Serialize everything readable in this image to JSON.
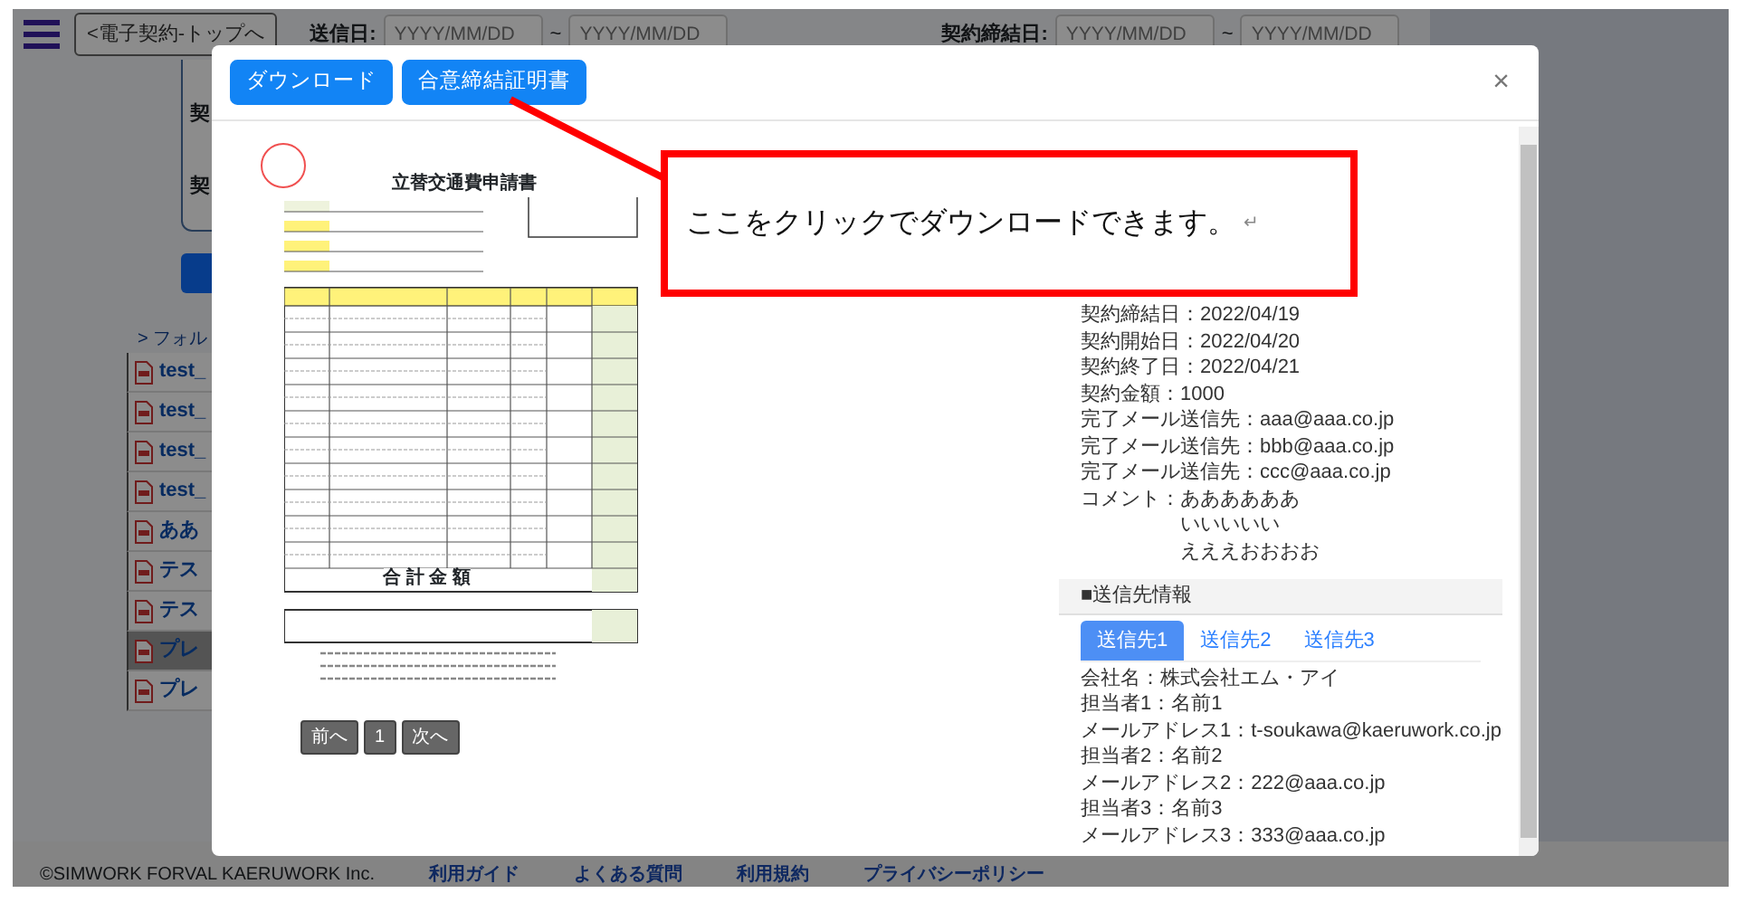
{
  "background_page": {
    "top_link": "<電子契約-トップへ",
    "filters": [
      {
        "label": "送信日:",
        "from_placeholder": "YYYY/MM/DD",
        "separator": "~",
        "to_placeholder": "YYYY/MM/DD"
      },
      {
        "label": "契約締結日:",
        "from_placeholder": "YYYY/MM/DD",
        "separator": "~",
        "to_placeholder": "YYYY/MM/DD"
      }
    ],
    "side_labels": [
      "契",
      "契"
    ],
    "folder_link": "> フォル",
    "files": [
      {
        "name": "test_",
        "selected": false
      },
      {
        "name": "test_",
        "selected": false
      },
      {
        "name": "test_",
        "selected": false
      },
      {
        "name": "test_",
        "selected": false
      },
      {
        "name": "ああ",
        "selected": false
      },
      {
        "name": "テス",
        "selected": false
      },
      {
        "name": "テス",
        "selected": false
      },
      {
        "name": "プレ",
        "selected": true
      },
      {
        "name": "プレ",
        "selected": false
      }
    ]
  },
  "modal": {
    "buttons": [
      "ダウンロード",
      "合意締結証明書"
    ],
    "close": "×",
    "document": {
      "title": "立替交通費申請書",
      "total_label": "合 計 金 額"
    },
    "pager": [
      "前へ",
      "1",
      "次へ"
    ],
    "contract_info": [
      "契約締結日：2022/04/19",
      "契約開始日：2022/04/20",
      "契約終了日：2022/04/21",
      "契約金額：1000",
      "完了メール送信先：aaa@aaa.co.jp",
      "完了メール送信先：bbb@aaa.co.jp",
      "完了メール送信先：ccc@aaa.co.jp"
    ],
    "comment": {
      "label": "コメント：",
      "lines": [
        "ああああああ",
        "いいいいい",
        "えええおおおお"
      ]
    },
    "recipients": {
      "title": "■送信先情報",
      "tabs": [
        {
          "label": "送信先1",
          "selected": true
        },
        {
          "label": "送信先2",
          "selected": false
        },
        {
          "label": "送信先3",
          "selected": false
        }
      ],
      "lines": [
        "会社名：株式会社エム・アイ",
        "担当者1：名前1",
        "メールアドレス1：t-soukawa@kaeruwork.co.jp",
        "担当者2：名前2",
        "メールアドレス2：222@aaa.co.jp",
        "担当者3：名前3",
        "メールアドレス3：333@aaa.co.jp"
      ]
    }
  },
  "callout": {
    "text": "ここをクリックでダウンロードできます。",
    "mark": "↵"
  },
  "footer": {
    "copyright": "©SIMWORK FORVAL KAERUWORK Inc.",
    "links": [
      "利用ガイド",
      "よくある質問",
      "利用規約",
      "プライバシーポリシー"
    ]
  }
}
